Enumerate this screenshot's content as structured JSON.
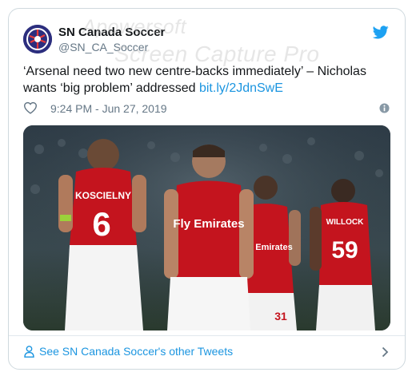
{
  "account": {
    "display_name": "SN Canada Soccer",
    "handle": "@SN_CA_Soccer"
  },
  "watermark": {
    "line1": "Apowersoft",
    "line2": "Screen Capture Pro"
  },
  "tweet": {
    "text": "‘Arsenal need two new centre-backs immediately’ – Nicholas wants ‘big problem’ addressed ",
    "link": "bit.ly/2JdnSwE",
    "timestamp": "9:24 PM - Jun 27, 2019"
  },
  "photo": {
    "jerseys": [
      {
        "name": "KOSCIELNY",
        "number": "6",
        "sponsor": ""
      },
      {
        "name": "",
        "number": "",
        "sponsor": "Fly Emirates"
      },
      {
        "name": "",
        "number": "31",
        "sponsor": "Fly Emirates"
      },
      {
        "name": "WILLOCK",
        "number": "59",
        "sponsor": ""
      }
    ]
  },
  "footer": {
    "link_label": "See SN Canada Soccer's other Tweets"
  },
  "colors": {
    "link": "#1b95e0",
    "twitter_blue": "#1da1f2",
    "secondary_text": "#657786",
    "arsenal_red": "#d1121f"
  },
  "icons": [
    "avatar-logo",
    "twitter-bird-icon",
    "heart-icon",
    "info-icon",
    "person-icon",
    "chevron-right-icon"
  ]
}
